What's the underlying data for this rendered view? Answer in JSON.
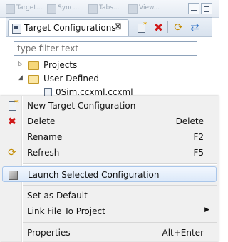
{
  "top_toolbar": {
    "items": [
      "Target...",
      "Sync...",
      "Tabs...",
      "View..."
    ]
  },
  "view": {
    "tab_label": "Target Configurations",
    "tab_close": "⊠",
    "filter_placeholder": "type filter text",
    "tree": {
      "projects_label": "Projects",
      "user_defined_label": "User Defined",
      "file_label": "0Sim.ccxml.ccxml"
    }
  },
  "menu": {
    "items": [
      {
        "label": "New Target Configuration",
        "shortcut": "",
        "icon": "new-target-icon"
      },
      {
        "label": "Delete",
        "shortcut": "Delete",
        "icon": "delete-icon"
      },
      {
        "label": "Rename",
        "shortcut": "F2",
        "icon": ""
      },
      {
        "label": "Refresh",
        "shortcut": "F5",
        "icon": "refresh-icon"
      },
      {
        "label": "Launch Selected Configuration",
        "shortcut": "",
        "icon": "launch-icon"
      },
      {
        "label": "Set as Default",
        "shortcut": "",
        "icon": ""
      },
      {
        "label": "Link File To Project",
        "shortcut": "",
        "icon": ""
      },
      {
        "label": "Properties",
        "shortcut": "Alt+Enter",
        "icon": ""
      }
    ]
  },
  "colors": {
    "menu_highlight": "#dce9f9",
    "menu_highlight_border": "#a9c6ea",
    "delete_red": "#d01818"
  }
}
